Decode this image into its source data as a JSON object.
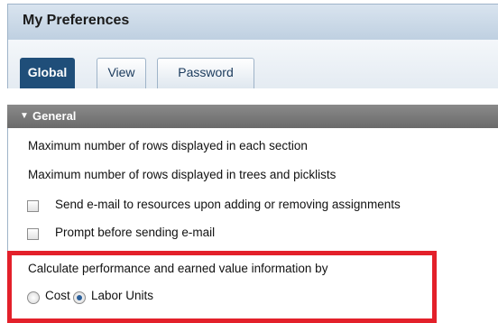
{
  "header": {
    "title": "My Preferences"
  },
  "tabs": [
    {
      "label": "Global",
      "active": true
    },
    {
      "label": "View",
      "active": false
    },
    {
      "label": "Password",
      "active": false
    }
  ],
  "section": {
    "title": "General",
    "expanded": true
  },
  "settings": {
    "max_rows_section": "Maximum number of rows displayed in each section",
    "max_rows_trees": "Maximum number of rows displayed in trees and picklists",
    "send_email": {
      "label": "Send e-mail to resources upon adding or removing assignments",
      "checked": false
    },
    "prompt_email": {
      "label": "Prompt before sending e-mail",
      "checked": false
    }
  },
  "calculation": {
    "prompt": "Calculate performance and earned value information by",
    "options": [
      {
        "label": "Cost",
        "selected": false
      },
      {
        "label": "Labor Units",
        "selected": true
      }
    ]
  },
  "colors": {
    "accent": "#1f4e79",
    "highlight": "#e3202a",
    "section_header": "#777777"
  }
}
